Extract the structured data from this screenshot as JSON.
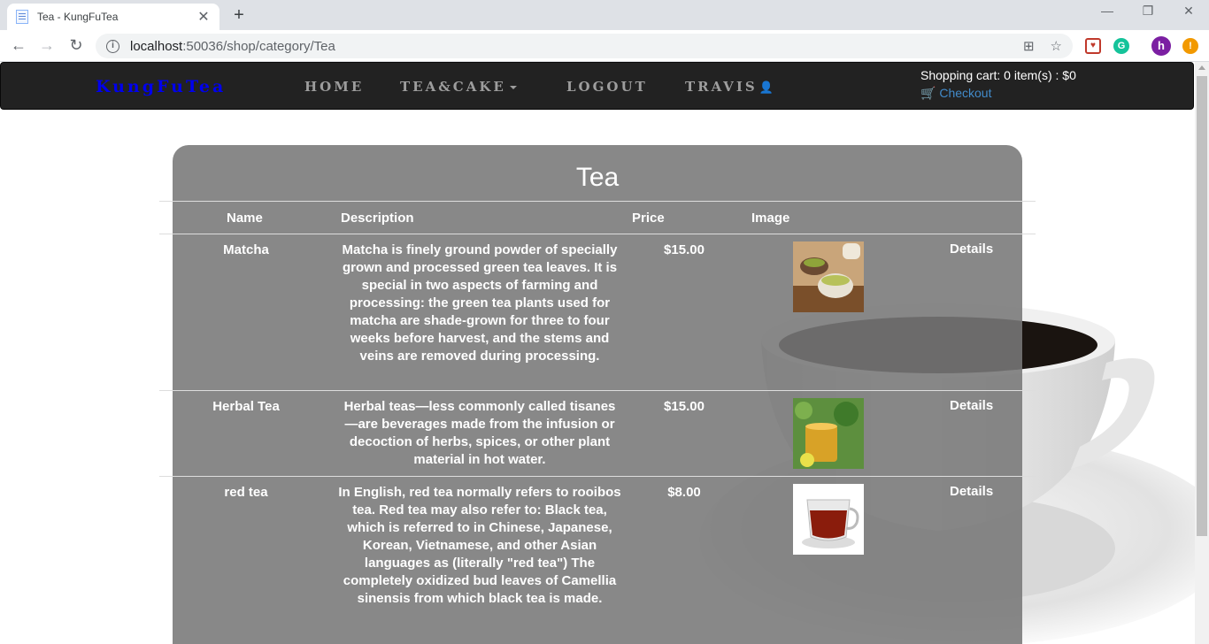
{
  "browser": {
    "tab_title": "Tea - KungFuTea",
    "url_host": "localhost",
    "url_path": ":50036/shop/category/Tea",
    "profile_initial": "h"
  },
  "nav": {
    "brand": "KungFuTea",
    "home": "HOME",
    "tea_cake": "TEA&CAKE",
    "logout": "LOGOUT",
    "user": "TRAVIS",
    "cart_text": "Shopping cart: 0 item(s) : $0",
    "checkout": "Checkout"
  },
  "category": {
    "title": "Tea",
    "headers": {
      "name": "Name",
      "description": "Description",
      "price": "Price",
      "image": "Image"
    },
    "details_label": "Details",
    "products": [
      {
        "name": "Matcha",
        "description": "Matcha is finely ground powder of specially grown and processed green tea leaves. It is special in two aspects of farming and processing: the green tea plants used for matcha are shade-grown for three to four weeks before harvest, and the stems and veins are removed during processing.",
        "price": "$15.00"
      },
      {
        "name": "Herbal Tea",
        "description": "Herbal teas—less commonly called tisanes —are beverages made from the infusion or decoction of herbs, spices, or other plant material in hot water.",
        "price": "$15.00"
      },
      {
        "name": "red tea",
        "description": "In English, red tea normally refers to rooibos tea. Red tea may also refer to: Black tea, which is referred to in Chinese, Japanese, Korean, Vietnamese, and other Asian languages as (literally \"red tea\") The completely oxidized bud leaves of Camellia sinensis from which black tea is made.",
        "price": "$8.00"
      }
    ]
  }
}
